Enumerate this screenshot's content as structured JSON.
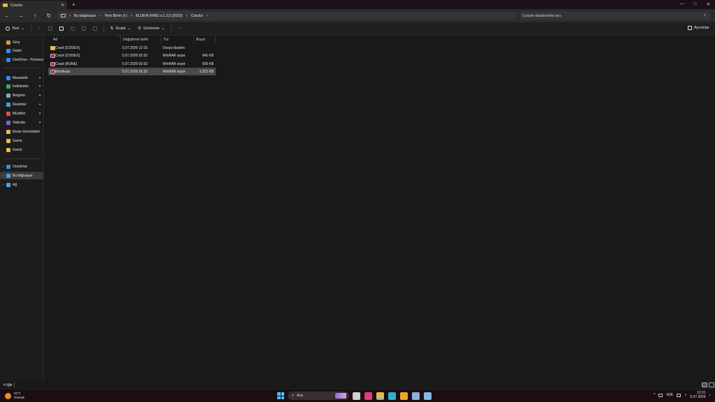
{
  "window": {
    "tab_title": "Cracks",
    "new_tab": "+",
    "controls": {
      "minimize": "—",
      "maximize": "□",
      "close": "✕"
    }
  },
  "nav": {
    "back": "←",
    "forward": "→",
    "up": "↑",
    "refresh": "↻",
    "breadcrumbs": [
      "Bu bilgisayar",
      "Yeni Birim (I:)",
      "ELDEN RING v.1.13 (2022)",
      "Cracks"
    ],
    "search_placeholder": "Cracks klasöründe ara"
  },
  "toolbar": {
    "new_label": "Yeni",
    "sort_label": "Sırala",
    "view_label": "Görünüm",
    "more_label": "···",
    "details_label": "Ayrıntılar"
  },
  "sidebar": {
    "quick": [
      {
        "label": "Giriş",
        "color": "#e09a3a"
      },
      {
        "label": "Galeri",
        "color": "#3a8ee6"
      }
    ],
    "onedrive_personal": {
      "label": "OneDrive - Persona",
      "color": "#2f8ef0"
    },
    "pinned": [
      {
        "label": "Masaüstü",
        "color": "#2f8ef0",
        "pinned": true
      },
      {
        "label": "İndirilenler",
        "color": "#2fb06a",
        "pinned": true
      },
      {
        "label": "Belgeler",
        "color": "#8fa6c4",
        "pinned": true
      },
      {
        "label": "Resimler",
        "color": "#3aa0e8",
        "pinned": true
      },
      {
        "label": "Müzikler",
        "color": "#e0504a",
        "pinned": true
      },
      {
        "label": "Videolar",
        "color": "#8a5ae0",
        "pinned": true
      },
      {
        "label": "Ekran Görüntüleri",
        "color": "#e8b84a",
        "pinned": false
      },
      {
        "label": "Game",
        "color": "#e8b84a",
        "pinned": false
      },
      {
        "label": "Game",
        "color": "#e8b84a",
        "pinned": false
      }
    ],
    "locations": [
      {
        "label": "OneDrive",
        "color": "#2f8ef0",
        "selected": false
      },
      {
        "label": "Bu bilgisayar",
        "color": "#4aa0e8",
        "selected": true
      },
      {
        "label": "Ağ",
        "color": "#4aa0e8",
        "selected": false
      }
    ]
  },
  "columns": {
    "name": "Ad",
    "date": "Değiştirme tarihi",
    "type": "Tür",
    "size": "Boyut"
  },
  "files": [
    {
      "name": "Crack [CODEX]",
      "date": "5.07.2026 12:10",
      "type": "Dosya klasörü",
      "size": "",
      "kind": "folder",
      "selected": false
    },
    {
      "name": "Crack [CODEX]",
      "date": "5.07.2026 02:32",
      "type": "WinRAR arşivi",
      "size": "645 KB",
      "kind": "rar",
      "selected": false
    },
    {
      "name": "Crack [RUNE]",
      "date": "5.07.2026 02:32",
      "type": "WinRAR arşivi",
      "size": "509 KB",
      "kind": "rar",
      "selected": false
    },
    {
      "name": "Manifests",
      "date": "5.07.2026 02:32",
      "type": "WinRAR arşivi",
      "size": "3.322 KB",
      "kind": "rar",
      "selected": true
    }
  ],
  "status": {
    "count": "4 öğe"
  },
  "taskbar": {
    "temperature": "32°C",
    "weather": "Güneşli",
    "search_label": "Ara",
    "lang": "AZE",
    "time": "12:31",
    "date": "5.07.2026",
    "apps": [
      {
        "name": "task-view",
        "color": "#cfcfcf",
        "active": false
      },
      {
        "name": "instagram",
        "color": "#d9407a",
        "active": false
      },
      {
        "name": "file-explorer",
        "color": "#e8b84a",
        "active": true
      },
      {
        "name": "edge",
        "color": "#2fb0c8",
        "active": false
      },
      {
        "name": "chrome",
        "color": "#e8a82a",
        "active": false
      },
      {
        "name": "app-6",
        "color": "#8fb0d8",
        "active": false
      },
      {
        "name": "steam",
        "color": "#7fb8e8",
        "active": false
      }
    ]
  }
}
